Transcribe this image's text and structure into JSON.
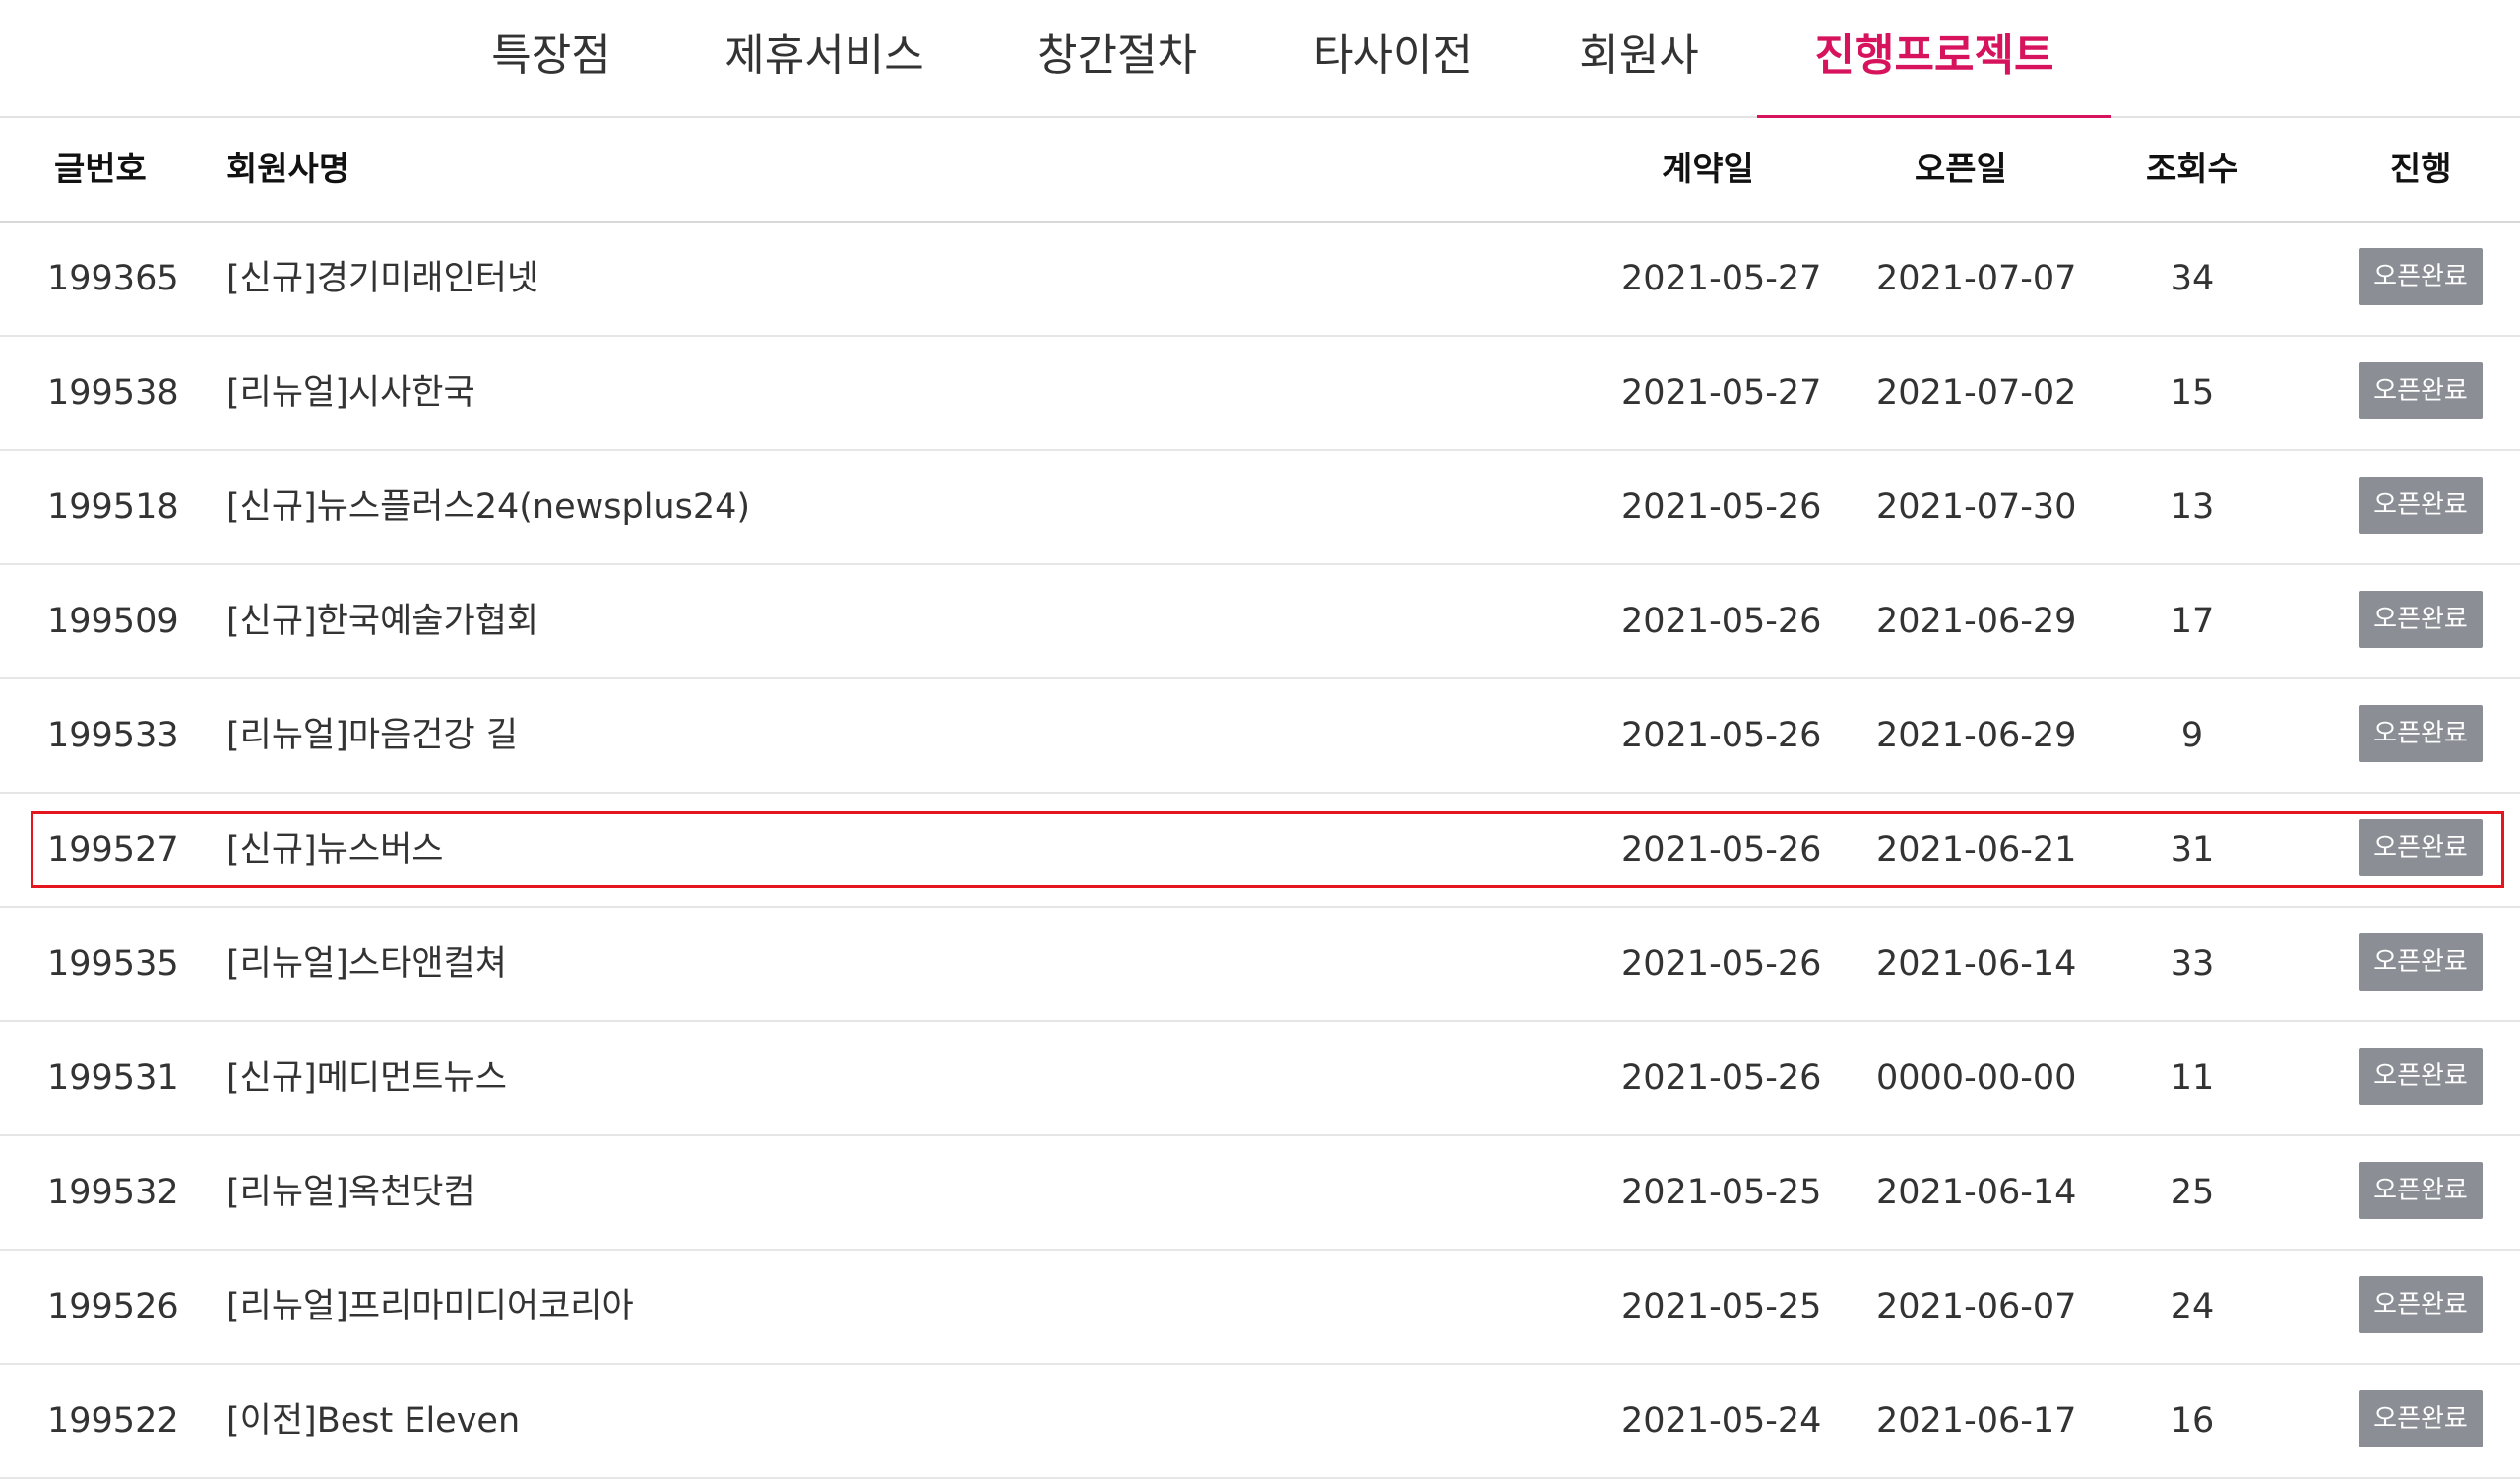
{
  "tabs": [
    {
      "label": "특장점"
    },
    {
      "label": "제휴서비스"
    },
    {
      "label": "창간절차"
    },
    {
      "label": "타사이전"
    },
    {
      "label": "회원사"
    },
    {
      "label": "진행프로젝트"
    }
  ],
  "active_tab": "진행프로젝트",
  "colors": {
    "accent": "#d6135c",
    "badge": "#8b8e94",
    "highlight": "#e4151f"
  },
  "table": {
    "headers": {
      "num": "글번호",
      "name": "회원사명",
      "contract": "계약일",
      "open": "오픈일",
      "views": "조회수",
      "status": "진행"
    },
    "rows": [
      {
        "num": "199365",
        "name": "[신규]경기미래인터넷",
        "contract": "2021-05-27",
        "open": "2021-07-07",
        "views": "34",
        "status": "오픈완료"
      },
      {
        "num": "199538",
        "name": "[리뉴얼]시사한국",
        "contract": "2021-05-27",
        "open": "2021-07-02",
        "views": "15",
        "status": "오픈완료"
      },
      {
        "num": "199518",
        "name": "[신규]뉴스플러스24(newsplus24)",
        "contract": "2021-05-26",
        "open": "2021-07-30",
        "views": "13",
        "status": "오픈완료"
      },
      {
        "num": "199509",
        "name": "[신규]한국예술가협회",
        "contract": "2021-05-26",
        "open": "2021-06-29",
        "views": "17",
        "status": "오픈완료"
      },
      {
        "num": "199533",
        "name": "[리뉴얼]마음건강 길",
        "contract": "2021-05-26",
        "open": "2021-06-29",
        "views": "9",
        "status": "오픈완료"
      },
      {
        "num": "199527",
        "name": "[신규]뉴스버스",
        "contract": "2021-05-26",
        "open": "2021-06-21",
        "views": "31",
        "status": "오픈완료"
      },
      {
        "num": "199535",
        "name": "[리뉴얼]스타앤컬쳐",
        "contract": "2021-05-26",
        "open": "2021-06-14",
        "views": "33",
        "status": "오픈완료"
      },
      {
        "num": "199531",
        "name": "[신규]메디먼트뉴스",
        "contract": "2021-05-26",
        "open": "0000-00-00",
        "views": "11",
        "status": "오픈완료"
      },
      {
        "num": "199532",
        "name": "[리뉴얼]옥천닷컴",
        "contract": "2021-05-25",
        "open": "2021-06-14",
        "views": "25",
        "status": "오픈완료"
      },
      {
        "num": "199526",
        "name": "[리뉴얼]프리마미디어코리아",
        "contract": "2021-05-25",
        "open": "2021-06-07",
        "views": "24",
        "status": "오픈완료"
      },
      {
        "num": "199522",
        "name": "[이전]Best Eleven",
        "contract": "2021-05-24",
        "open": "2021-06-17",
        "views": "16",
        "status": "오픈완료"
      }
    ]
  }
}
